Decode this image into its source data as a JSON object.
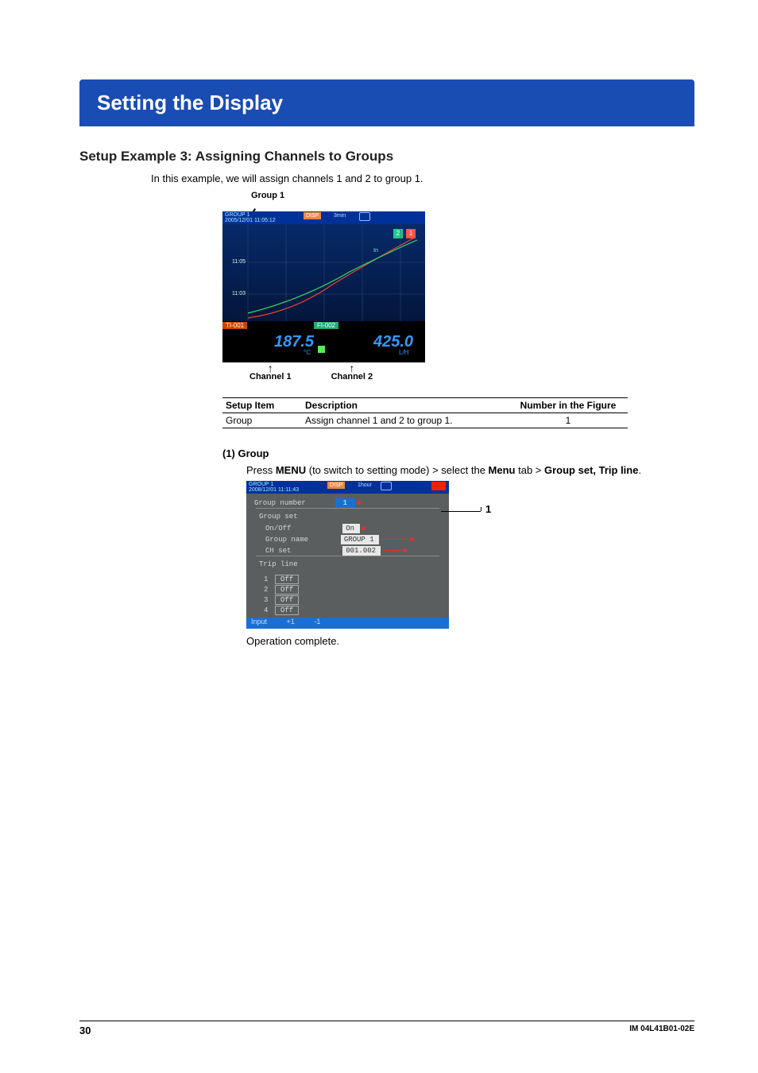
{
  "title_bar": "Setting the Display",
  "subtitle": "Setup Example 3: Assigning Channels to Groups",
  "intro": "In this example, we will assign channels 1 and 2 to group 1.",
  "group_label": "Group 1",
  "shot1": {
    "group": "GROUP 1",
    "datetime": "2005/12/01 11:05:12",
    "disp": "DISP",
    "interval": "3min",
    "time1": "11:05",
    "time2": "11:03",
    "badge2": "2",
    "badge1": "1",
    "in_label": "In",
    "tag1": "TI-001",
    "tag2": "FI-002",
    "val1": "187.5",
    "unit1": "°C",
    "val2": "425.0",
    "unit2": "L/H"
  },
  "chan1_label": "Channel 1",
  "chan2_label": "Channel 2",
  "table": {
    "h1": "Setup Item",
    "h2": "Description",
    "h3": "Number in the Figure",
    "r1c1": "Group",
    "r1c2": "Assign channel 1 and 2 to group 1.",
    "r1c3": "1"
  },
  "sect_label": "(1) Group",
  "instr_pre": "Press ",
  "instr_b1": "MENU",
  "instr_mid1": " (to switch to setting mode) > select the ",
  "instr_b2": "Menu",
  "instr_mid2": " tab > ",
  "instr_b3": "Group set, Trip line",
  "instr_post": ".",
  "shot2": {
    "group": "GROUP 1",
    "datetime": "2008/12/01 11:11:43",
    "disp": "DISP",
    "interval": "1hour",
    "grpnum_lbl": "Group number",
    "grpnum_val": "1",
    "grpset_lbl": "Group set",
    "onoff_lbl": "On/Off",
    "onoff_val": "On",
    "grpname_lbl": "Group name",
    "grpname_val": "GROUP 1",
    "chset_lbl": "CH set",
    "chset_val": "001.002",
    "trip_lbl": "Trip line",
    "tl1": "Off",
    "tl2": "Off",
    "tl3": "Off",
    "tl4": "Off",
    "input": "Input",
    "plus1": "+1",
    "minus1": "-1"
  },
  "callout_1": "1",
  "op_complete": "Operation complete.",
  "footer": {
    "page": "30",
    "doc": "IM 04L41B01-02E"
  }
}
